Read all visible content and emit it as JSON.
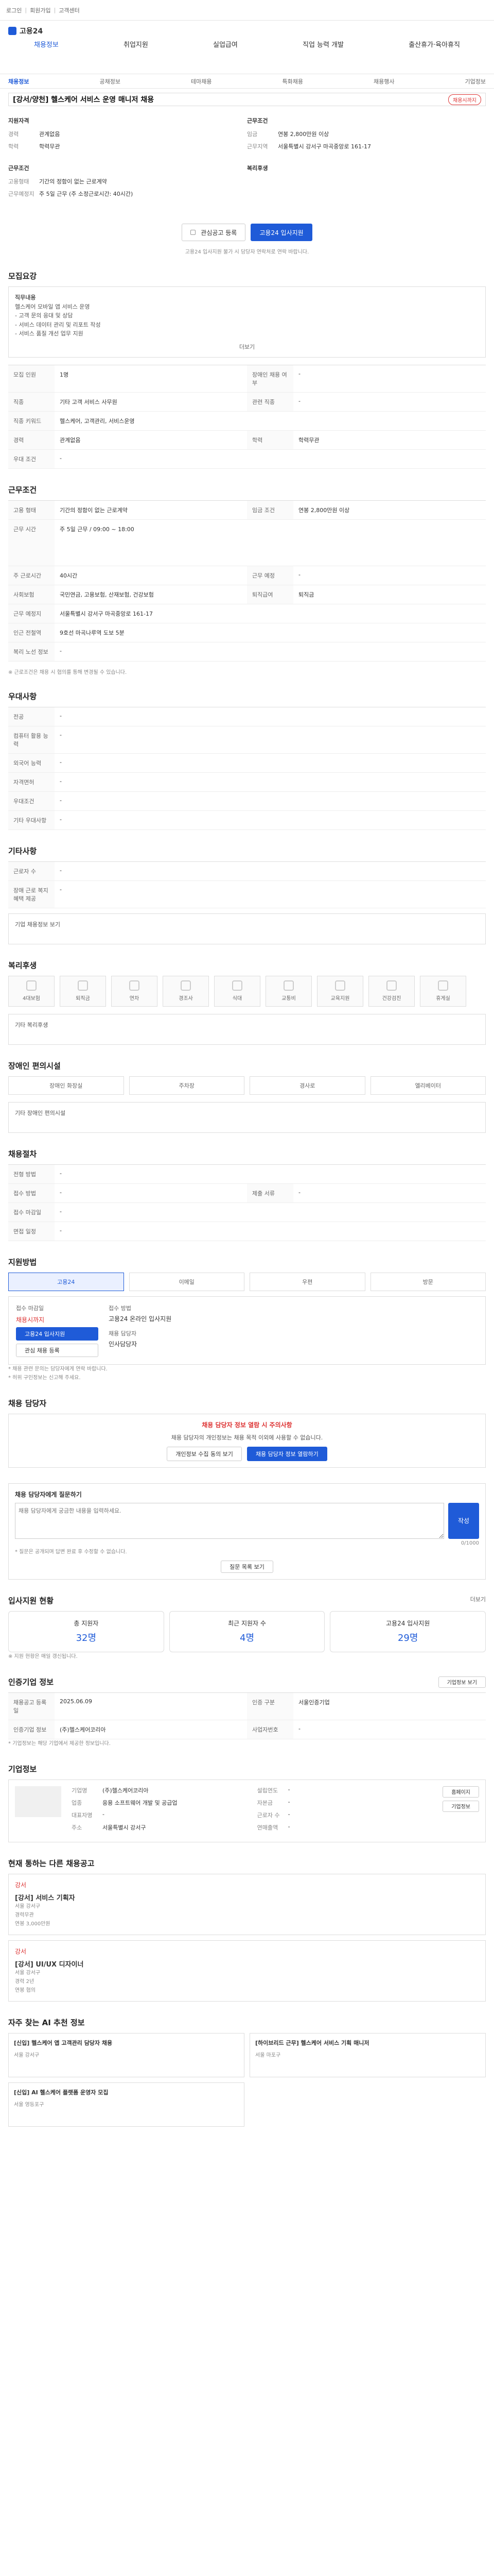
{
  "top": {
    "links": [
      "로그인",
      "회원가입",
      "고객센터"
    ]
  },
  "header": {
    "logo": "고용24",
    "nav": [
      "채용정보",
      "취업지원",
      "실업급여",
      "직업 능력 개발",
      "출산휴가·육아휴직"
    ]
  },
  "subnav": {
    "items": [
      "채용정보",
      "공채정보",
      "테마채용",
      "특화채용",
      "채용행사",
      "기업정보"
    ],
    "active": "채용정보"
  },
  "job": {
    "title": "[강서/양천] 헬스케어 서비스 운영 매니저 채용",
    "badge": "채용시까지"
  },
  "summary": {
    "left_head": "지원자격",
    "left": [
      {
        "k": "경력",
        "v": "관계없음"
      },
      {
        "k": "학력",
        "v": "학력무관"
      }
    ],
    "left2_head": "근무조건",
    "left2": [
      {
        "k": "고용형태",
        "v": "기간의 정함이 없는 근로계약"
      },
      {
        "k": "근무예정지",
        "v": "주 5일 근무 (주 소정근로시간: 40시간)"
      }
    ],
    "right_head": "근무조건",
    "right": [
      {
        "k": "임금",
        "v": "연봉 2,800만원 이상"
      },
      {
        "k": "근무지역",
        "v": "서울특별시 강서구 마곡중앙로 161-17"
      }
    ],
    "right2_head": "복리후생",
    "btn_scrap": "관심공고 등록",
    "btn_apply": "고용24 입사지원",
    "note": "고용24 입사지원 불가 시 담당자 연락처로 연락 바랍니다."
  },
  "recruit": {
    "title": "모집요강",
    "head": "직무내용",
    "body": [
      "헬스케어 모바일 앱 서비스 운영",
      "- 고객 문의 응대 및 상담",
      "- 서비스 데이터 관리 및 리포트 작성",
      "- 서비스 품질 개선 업무 지원"
    ],
    "more": "더보기",
    "rows": [
      {
        "k": "모집 인원",
        "v": "1명",
        "k2": "장애인 채용 여부",
        "v2": "-"
      },
      {
        "k": "직종",
        "v": "기타 고객 서비스 사무원",
        "k2": "관련 직종",
        "v2": "-"
      },
      {
        "k": "직종 키워드",
        "v": "헬스케어, 고객관리, 서비스운영",
        "k2": "",
        "v2": ""
      },
      {
        "k": "경력",
        "v": "관계없음",
        "k2": "학력",
        "v2": "학력무관"
      },
      {
        "k": "우대 조건",
        "v": "-",
        "k2": "",
        "v2": ""
      }
    ]
  },
  "conditions": {
    "title": "근무조건",
    "rows": [
      {
        "k": "고용 형태",
        "v": "기간의 정함이 없는 근로계약",
        "k2": "임금 조건",
        "v2": "연봉 2,800만원 이상"
      },
      {
        "k": "근무 시간",
        "v": "주 5일 근무 / 09:00 ~ 18:00",
        "k2": "",
        "v2": ""
      },
      {
        "k": "주 근로시간",
        "v": "40시간",
        "k2": "근무 예정",
        "v2": "-"
      },
      {
        "k": "사회보험",
        "v": "국민연금, 고용보험, 산재보험, 건강보험",
        "k2": "퇴직급여",
        "v2": "퇴직금"
      },
      {
        "k": "근무 예정지",
        "v": "서울특별시 강서구 마곡중앙로 161-17",
        "k2": "",
        "v2": ""
      },
      {
        "k": "인근 전철역",
        "v": "9호선 마곡나루역 도보 5분",
        "k2": "",
        "v2": ""
      },
      {
        "k": "복리 노선 정보",
        "v": "-",
        "k2": "",
        "v2": ""
      }
    ],
    "note": "※ 근로조건은 채용 시 협의를 통해 변경될 수 있습니다."
  },
  "pref": {
    "title": "우대사항",
    "rows": [
      {
        "k": "전공",
        "v": "-"
      },
      {
        "k": "컴퓨터 활용 능력",
        "v": "-"
      },
      {
        "k": "외국어 능력",
        "v": "-"
      },
      {
        "k": "자격면허",
        "v": "-"
      },
      {
        "k": "우대조건",
        "v": "-"
      },
      {
        "k": "기타 우대사항",
        "v": "-"
      }
    ]
  },
  "other": {
    "title": "기타사항",
    "rows": [
      {
        "k": "근로자 수",
        "v": "-"
      },
      {
        "k": "장애 근로 복지 혜택 제공",
        "v": "-"
      }
    ],
    "more": "기업 채용정보 보기"
  },
  "welfare": {
    "title": "복리후생",
    "items": [
      "4대보험",
      "퇴직금",
      "연차",
      "경조사",
      "식대",
      "교통비",
      "교육지원",
      "건강검진",
      "휴게실"
    ],
    "head": "기타 복리후생"
  },
  "disability": {
    "title": "장애인 편의시설",
    "items": [
      "장애인 화장실",
      "주차장",
      "경사로",
      "엘리베이터"
    ],
    "head": "기타 장애인 편의시설"
  },
  "interview": {
    "title": "채용절차",
    "rows": [
      {
        "k": "전형 방법",
        "v": "-",
        "k2": "",
        "v2": ""
      },
      {
        "k": "접수 방법",
        "v": "-",
        "k2": "제출 서류",
        "v2": "-"
      },
      {
        "k": "접수 마감일",
        "v": "-",
        "k2": "",
        "v2": ""
      },
      {
        "k": "면접 일정",
        "v": "-",
        "k2": "",
        "v2": ""
      }
    ]
  },
  "apply": {
    "title": "지원방법",
    "tabs": [
      "고용24",
      "이메일",
      "우편",
      "방문"
    ],
    "left_head": "접수 마감일",
    "left_sub": "채용시까지",
    "btn1": "고용24 입사지원",
    "btn2": "관심 채용 등록",
    "right_head": "접수 방법",
    "right_sub": "고용24 온라인 입사지원",
    "right_head2": "채용 담당자",
    "right_sub2": "인사담당자",
    "notes": [
      "* 채용 관련 문의는 담당자에게 연락 바랍니다.",
      "* 허위 구인정보는 신고해 주세요."
    ]
  },
  "inquiry": {
    "title": "채용 담당자",
    "alert": "채용 담당자 정보 열람 시 주의사항",
    "desc": "채용 담당자의 개인정보는 채용 목적 이외에 사용할 수 없습니다.",
    "btn1": "개인정보 수집 동의 보기",
    "btn2": "채용 담당자 정보 열람하기"
  },
  "qna": {
    "title": "채용 담당자에게 질문하기",
    "placeholder": "채용 담당자에게 궁금한 내용을 입력하세요.",
    "count": "0/1000",
    "btn": "작성",
    "notes": [
      "* 질문은 공개되며 답변 완료 후 수정할 수 없습니다."
    ],
    "more": "질문 목록 보기"
  },
  "status": {
    "title": "입사지원 현황",
    "more": "더보기",
    "stats": [
      {
        "k": "총 지원자",
        "v": "32명"
      },
      {
        "k": "최근 지원자 수",
        "v": "4명"
      },
      {
        "k": "고용24 입사지원",
        "v": "29명"
      }
    ],
    "note": "※ 지원 현황은 매일 갱신됩니다."
  },
  "company": {
    "title": "인증기업 정보",
    "btn": "기업정보 보기",
    "rows": [
      {
        "k": "채용공고 등록일",
        "v": "2025.06.09",
        "k2": "인증 구분",
        "v2": "서울인증기업"
      },
      {
        "k": "인증기업 정보",
        "v": "(주)헬스케어코리아",
        "k2": "사업자번호",
        "v2": "-"
      }
    ],
    "notes": [
      "* 기업정보는 해당 기업에서 제공한 정보입니다."
    ]
  },
  "corp": {
    "title": "기업정보",
    "rows": [
      {
        "k": "기업명",
        "v": "(주)헬스케어코리아"
      },
      {
        "k": "업종",
        "v": "응용 소프트웨어 개발 및 공급업"
      },
      {
        "k": "대표자명",
        "v": "-"
      },
      {
        "k": "주소",
        "v": "서울특별시 강서구"
      }
    ],
    "right": [
      {
        "k": "설립연도",
        "v": "-"
      },
      {
        "k": "자본금",
        "v": "-"
      },
      {
        "k": "근로자 수",
        "v": "-"
      },
      {
        "k": "연매출액",
        "v": "-"
      }
    ],
    "btn1": "홈페이지",
    "btn2": "기업정보"
  },
  "similar": {
    "title": "현재 통하는 다른 채용공고",
    "items": [
      {
        "tag": "강서",
        "t": "[강서] 서비스 기획자",
        "a": "서울 강서구",
        "b": "경력무관",
        "c": "연봉 3,000만원"
      },
      {
        "tag": "강서",
        "t": "[강서] UI/UX 디자이너",
        "a": "서울 강서구",
        "b": "경력 2년",
        "c": "연봉 협의"
      }
    ]
  },
  "ai": {
    "title": "자주 찾는 AI 추천 정보",
    "items": [
      {
        "t": "[신입] 헬스케어 앱 고객관리 담당자 채용",
        "s": "서울 강서구"
      },
      {
        "t": "[하이브리드 근무] 헬스케어 서비스 기획 매니저",
        "s": "서울 마포구"
      },
      {
        "t": "[신입] AI 헬스케어 플랫폼 운영자 모집",
        "s": "서울 영등포구"
      }
    ]
  }
}
